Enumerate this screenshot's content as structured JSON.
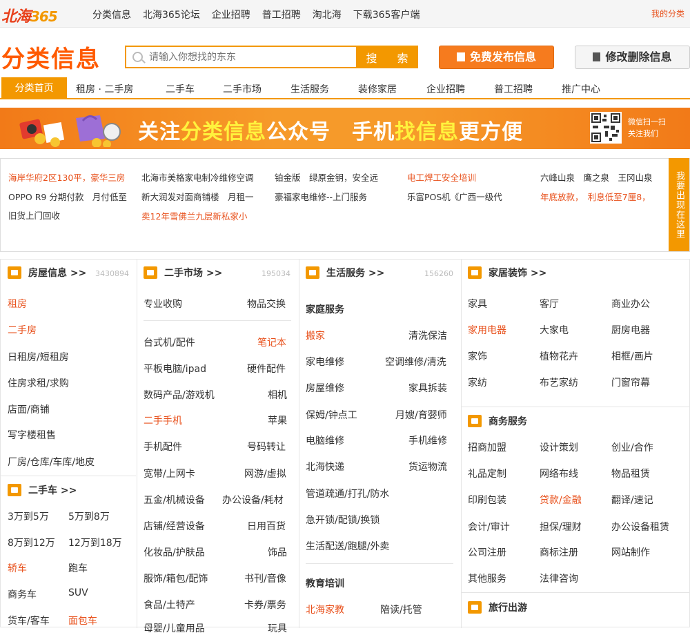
{
  "topbar": {
    "logo_text": "北海",
    "logo_num": "365",
    "nav": [
      "分类信息",
      "北海365论坛",
      "企业招聘",
      "普工招聘",
      "淘北海",
      "下载365客户端"
    ],
    "my_category": "我的分类"
  },
  "header": {
    "brand": "分类信息",
    "search_placeholder": "请输入你想找的东东",
    "search_button": "搜 索",
    "publish_button": "免费发布信息",
    "edit_button": "修改删除信息"
  },
  "nav": {
    "home": "分类首页",
    "items": [
      "租房 · 二手房",
      "二手车",
      "二手市场",
      "生活服务",
      "装修家居",
      "企业招聘",
      "普工招聘",
      "推广中心"
    ]
  },
  "banner": {
    "text_a": "关注",
    "text_b": "分类信息",
    "text_c": "公众号　手机",
    "text_d": "找信息",
    "text_e": "更方便",
    "qr_note_1": "微信扫一扫",
    "qr_note_2": "关注我们"
  },
  "ads": {
    "a1": "海岸华府2区130平，豪华三房",
    "a2": "OPPO R9 分期付款　月付低至",
    "a3": "旧货上门回收",
    "b1": "北海市美格家电制冷维修空调",
    "b2": "新大润发对面商铺楼　月租一",
    "b3": "卖12年雪佛兰九层新私家小",
    "c1": "铂金版　绿原金钥，安全远",
    "c2": "豪福家电维修--上门服务",
    "d1": "电工焊工安全培训",
    "d2": "乐富POS机《广西一级代",
    "e1": "六峰山泉　鹰之泉　王冈山泉",
    "e2": "年底放款，　利息低至7厘8，",
    "side": "我要出现在这里"
  },
  "house": {
    "title": "房屋信息 >>",
    "count": "3430894",
    "links": [
      "租房",
      "二手房",
      "日租房/短租房",
      "住房求租/求购",
      "店面/商铺",
      "写字楼租售",
      "厂房/仓库/车库/地皮"
    ]
  },
  "car": {
    "title": "二手车 >>",
    "links": [
      "3万到5万",
      "5万到8万",
      "8万到12万",
      "12万到18万",
      "轿车",
      "跑车",
      "商务车",
      "SUV",
      "货车/客车",
      "面包车"
    ]
  },
  "market": {
    "title": "二手市场 >>",
    "count": "195034",
    "links": [
      "专业收购",
      "物品交换",
      "台式机/配件",
      "笔记本",
      "平板电脑/ipad",
      "硬件配件",
      "数码产品/游戏机",
      "相机",
      "二手手机",
      "苹果",
      "手机配件",
      "号码转让",
      "宽带/上网卡",
      "网游/虚拟",
      "五金/机械设备",
      "办公设备/耗材",
      "店铺/经营设备",
      "日用百货",
      "化妆品/护肤品",
      "饰品",
      "服饰/箱包/配饰",
      "书刊/音像",
      "食品/土特产",
      "卡券/票务",
      "母婴/儿童用品",
      "玩具"
    ]
  },
  "life": {
    "title": "生活服务 >>",
    "count": "156260",
    "sub1": "家庭服务",
    "links": [
      "搬家",
      "清洗保洁",
      "家电维修",
      "空调维修/清洗",
      "房屋维修",
      "家具拆装",
      "保姆/钟点工",
      "月嫂/育婴师",
      "电脑维修",
      "手机维修",
      "北海快递",
      "货运物流",
      "管道疏通/打孔/防水",
      "急开锁/配锁/换锁",
      "生活配送/跑腿/外卖"
    ],
    "sub2": "教育培训",
    "edu": [
      "北海家教",
      "陪读/托管"
    ]
  },
  "home_deco": {
    "title": "家居装饰 >>",
    "links": [
      "家具",
      "客厅",
      "商业办公",
      "家用电器",
      "大家电",
      "厨房电器",
      "家饰",
      "植物花卉",
      "相框/画片",
      "家纺",
      "布艺家纺",
      "门窗帘幕"
    ]
  },
  "biz": {
    "title": "商务服务",
    "links": [
      "招商加盟",
      "设计策划",
      "创业/合作",
      "礼品定制",
      "网络布线",
      "物品租赁",
      "印刷包装",
      "贷款/金融",
      "翻译/速记",
      "会计/审计",
      "担保/理财",
      "办公设备租赁",
      "公司注册",
      "商标注册",
      "网站制作",
      "其他服务",
      "法律咨询"
    ]
  },
  "travel": {
    "title": "旅行出游"
  },
  "colors": {
    "accent": "#f39800",
    "highlight": "#e8501b",
    "brand": "#ff5a00"
  }
}
